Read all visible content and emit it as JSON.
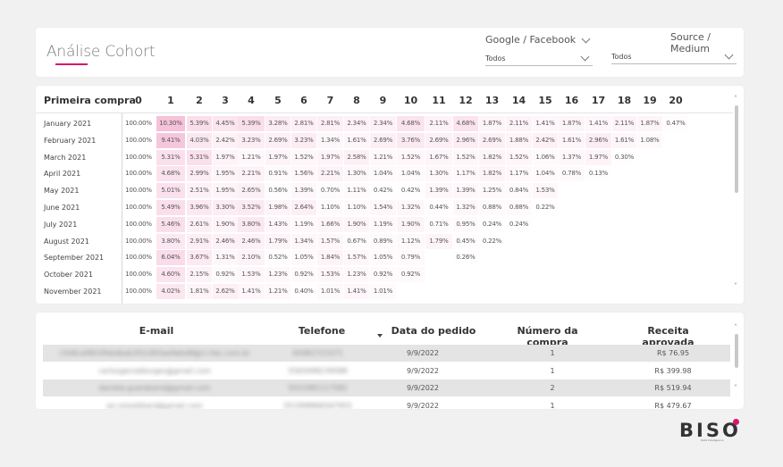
{
  "header": {
    "title": "Análise Cohort",
    "filter1": {
      "label": "Google / Facebook",
      "value": "Todos"
    },
    "filter2": {
      "label": "Source / Medium",
      "value": "Todos"
    }
  },
  "cohort": {
    "row_header": "Primeira compra",
    "columns": [
      "0",
      "1",
      "2",
      "3",
      "4",
      "5",
      "6",
      "7",
      "8",
      "9",
      "10",
      "11",
      "12",
      "13",
      "14",
      "15",
      "16",
      "17",
      "18",
      "19",
      "20"
    ],
    "rows": [
      {
        "label": "January 2021",
        "values": [
          "100.00%",
          "10.30%",
          "5.39%",
          "4.45%",
          "5.39%",
          "3.28%",
          "2.81%",
          "2.81%",
          "2.34%",
          "2.34%",
          "4.68%",
          "2.11%",
          "4.68%",
          "1.87%",
          "2.11%",
          "1.41%",
          "1.87%",
          "1.41%",
          "2.11%",
          "1.87%",
          "0.47%"
        ]
      },
      {
        "label": "February 2021",
        "values": [
          "100.00%",
          "9.41%",
          "4.03%",
          "2.42%",
          "3.23%",
          "2.69%",
          "3.23%",
          "1.34%",
          "1.61%",
          "2.69%",
          "3.76%",
          "2.69%",
          "2.96%",
          "2.69%",
          "1.88%",
          "2.42%",
          "1.61%",
          "2.96%",
          "1.61%",
          "1.08%"
        ]
      },
      {
        "label": "March 2021",
        "values": [
          "100.00%",
          "5.31%",
          "5.31%",
          "1.97%",
          "1.21%",
          "1.97%",
          "1.52%",
          "1.97%",
          "2.58%",
          "1.21%",
          "1.52%",
          "1.67%",
          "1.52%",
          "1.82%",
          "1.52%",
          "1.06%",
          "1.37%",
          "1.97%",
          "0.30%"
        ]
      },
      {
        "label": "April 2021",
        "values": [
          "100.00%",
          "4.68%",
          "2.99%",
          "1.95%",
          "2.21%",
          "0.91%",
          "1.56%",
          "2.21%",
          "1.30%",
          "1.04%",
          "1.04%",
          "1.30%",
          "1.17%",
          "1.82%",
          "1.17%",
          "1.04%",
          "0.78%",
          "0.13%"
        ]
      },
      {
        "label": "May 2021",
        "values": [
          "100.00%",
          "5.01%",
          "2.51%",
          "1.95%",
          "2.65%",
          "0.56%",
          "1.39%",
          "0.70%",
          "1.11%",
          "0.42%",
          "0.42%",
          "1.39%",
          "1.39%",
          "1.25%",
          "0.84%",
          "1.53%"
        ]
      },
      {
        "label": "June 2021",
        "values": [
          "100.00%",
          "5.49%",
          "3.96%",
          "3.30%",
          "3.52%",
          "1.98%",
          "2.64%",
          "1.10%",
          "1.10%",
          "1.54%",
          "1.32%",
          "0.44%",
          "1.32%",
          "0.88%",
          "0.88%",
          "0.22%"
        ]
      },
      {
        "label": "July 2021",
        "values": [
          "100.00%",
          "5.46%",
          "2.61%",
          "1.90%",
          "3.80%",
          "1.43%",
          "1.19%",
          "1.66%",
          "1.90%",
          "1.19%",
          "1.90%",
          "0.71%",
          "0.95%",
          "0.24%",
          "0.24%"
        ]
      },
      {
        "label": "August 2021",
        "values": [
          "100.00%",
          "3.80%",
          "2.91%",
          "2.46%",
          "2.46%",
          "1.79%",
          "1.34%",
          "1.57%",
          "0.67%",
          "0.89%",
          "1.12%",
          "1.79%",
          "0.45%",
          "0.22%"
        ]
      },
      {
        "label": "September 2021",
        "values": [
          "100.00%",
          "6.04%",
          "3.67%",
          "1.31%",
          "2.10%",
          "0.52%",
          "1.05%",
          "1.84%",
          "1.57%",
          "1.05%",
          "0.79%",
          "",
          "0.26%"
        ]
      },
      {
        "label": "October 2021",
        "values": [
          "100.00%",
          "4.60%",
          "2.15%",
          "0.92%",
          "1.53%",
          "1.23%",
          "0.92%",
          "1.53%",
          "1.23%",
          "0.92%",
          "0.92%"
        ]
      },
      {
        "label": "November 2021",
        "values": [
          "100.00%",
          "4.02%",
          "1.81%",
          "2.62%",
          "1.41%",
          "1.21%",
          "0.40%",
          "1.01%",
          "1.41%",
          "1.01%"
        ]
      }
    ]
  },
  "orders": {
    "headers": [
      "E-mail",
      "Telefone",
      "Data do pedido",
      "Número da compra",
      "Receita aprovada"
    ],
    "rows": [
      {
        "email": "c5d6ca9833febdbab3f2c083ae9ebd8@cl.rtec.com.br",
        "phone": "65982721071",
        "date": "9/9/2022",
        "number": "1",
        "revenue": "R$ 76.95"
      },
      {
        "email": "carlosgenialborges@gmail.com",
        "phone": "5565998239588",
        "date": "9/9/2022",
        "number": "1",
        "revenue": "R$ 399.98"
      },
      {
        "email": "daniela.guaraband@gmail.com",
        "phone": "5521981117582",
        "date": "9/9/2022",
        "number": "2",
        "revenue": "R$ 519.94"
      },
      {
        "email": "ex.rolosbtkard@gmail.com",
        "phone": "551998866567955",
        "date": "9/9/2022",
        "number": "1",
        "revenue": "R$ 479.67"
      }
    ]
  },
  "logo": {
    "text": "BISO",
    "sub": "Data Intelligence"
  },
  "colors": {
    "accent": "#d4186f",
    "heat": "#f9d9e8"
  }
}
